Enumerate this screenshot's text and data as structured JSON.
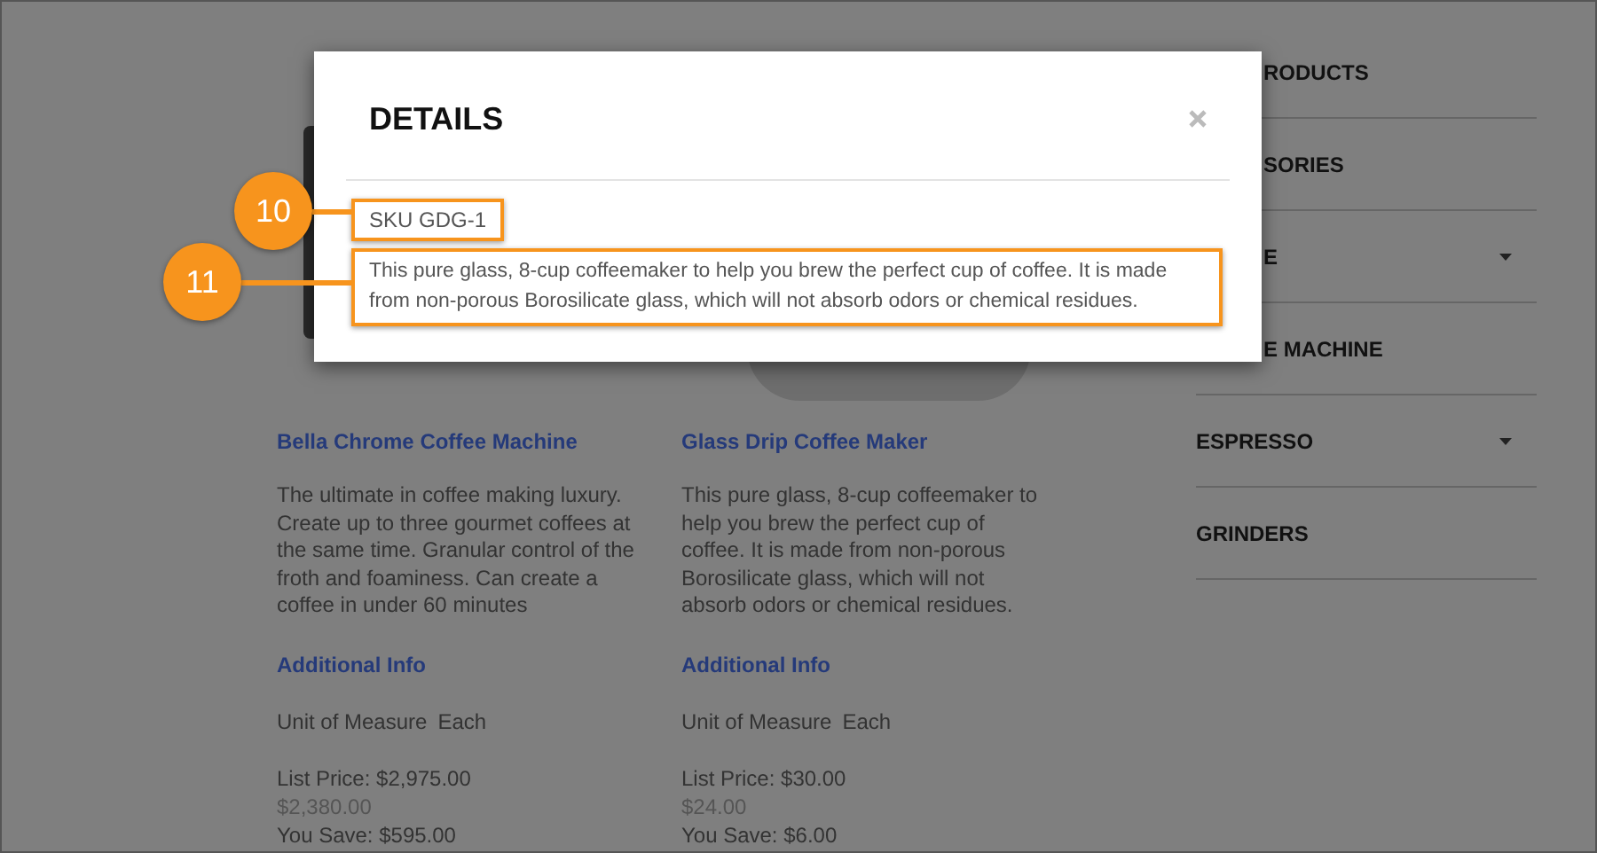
{
  "products": [
    {
      "title": "Bella Chrome Coffee Machine",
      "description": "The ultimate in coffee making luxury. Create up to three gourmet coffees at the same time. Granular control of the froth and foaminess. Can create a coffee in under 60 minutes",
      "info_heading": "Additional Info",
      "unit_label": "Unit of Measure",
      "unit_value": "Each",
      "list_price": "List Price: $2,975.00",
      "price": "$2,380.00",
      "savings": "You Save: $595.00"
    },
    {
      "title": "Glass Drip Coffee Maker",
      "description": "This pure glass, 8-cup coffeemaker to help you brew the perfect cup of coffee. It is made from non-porous Borosilicate glass, which will not absorb odors or chemical residues.",
      "info_heading": "Additional Info",
      "unit_label": "Unit of Measure",
      "unit_value": "Each",
      "list_price": "List Price: $30.00",
      "price": "$24.00",
      "savings": "You Save: $6.00"
    }
  ],
  "sidebar": {
    "items": [
      {
        "label": "RODUCTS",
        "covered": true,
        "has_submenu": false
      },
      {
        "label": "SORIES",
        "covered": true,
        "has_submenu": false
      },
      {
        "label": "E",
        "covered": true,
        "has_submenu": true
      },
      {
        "label": "E MACHINE",
        "covered": true,
        "has_submenu": false
      },
      {
        "label": "ESPRESSO",
        "covered": false,
        "has_submenu": true
      },
      {
        "label": "GRINDERS",
        "covered": false,
        "has_submenu": false
      }
    ]
  },
  "modal": {
    "title": "DETAILS",
    "sku": "SKU GDG-1",
    "description": "This pure glass, 8-cup coffeemaker to help you brew the perfect cup of coffee. It is made from non-porous Borosilicate glass, which will not absorb odors or chemical residues."
  },
  "callouts": [
    {
      "number": "10"
    },
    {
      "number": "11"
    }
  ]
}
